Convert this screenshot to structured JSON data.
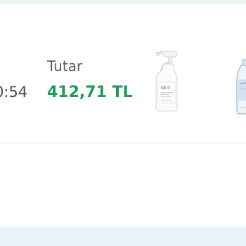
{
  "order": {
    "time_partial": "0:54",
    "total_label": "Tutar",
    "total_amount": "412,71 TL",
    "products": [
      {
        "icon": "spray-bottle-icon"
      },
      {
        "icon": "detergent-bottle-icon"
      }
    ]
  },
  "colors": {
    "page_background": "#eaf3fa",
    "card_background": "#ffffff",
    "amount_green": "#1e9b57",
    "divider": "#e3e6ea"
  }
}
